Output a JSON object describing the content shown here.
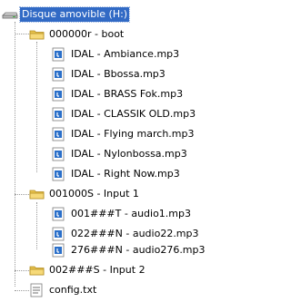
{
  "root": {
    "label": "Disque amovible (H:)"
  },
  "folders": [
    {
      "label": "000000r - boot",
      "files": [
        "IDAL - Ambiance.mp3",
        "IDAL - Bbossa.mp3",
        "IDAL - BRASS Fok.mp3",
        "IDAL - CLASSIK OLD.mp3",
        "IDAL - Flying march.mp3",
        "IDAL - Nylonbossa.mp3",
        "IDAL - Right Now.mp3"
      ]
    },
    {
      "label": "001000S - Input 1",
      "files": [
        "001###T - audio1.mp3",
        "022###N - audio22.mp3",
        "276###N - audio276.mp3"
      ]
    },
    {
      "label": "002###S - Input 2",
      "files": []
    }
  ],
  "root_files": [
    "config.txt"
  ],
  "icons": {
    "drive": "removable-drive-icon",
    "folder": "folder-icon",
    "audio": "audio-file-icon",
    "text": "text-file-icon"
  },
  "colors": {
    "selection": "#316ac5",
    "folder": "#f1cf5c",
    "audio": "#2a6fc9"
  }
}
